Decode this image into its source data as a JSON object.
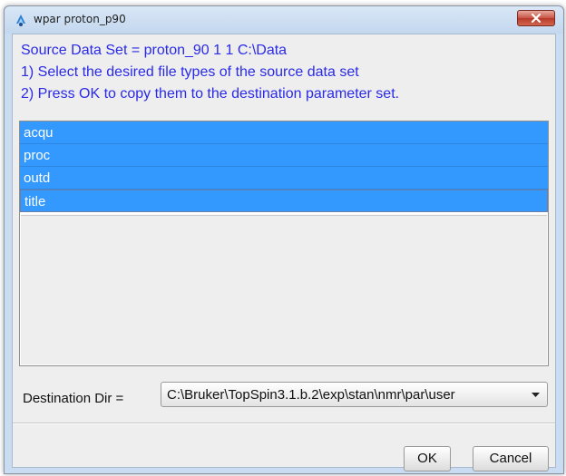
{
  "window": {
    "title": "wpar proton_p90"
  },
  "info": {
    "line1": "Source Data Set = proton_90  1  1  C:\\Data",
    "line2": "1) Select the desired file types of the source data set",
    "line3": "2) Press OK to copy them to the destination parameter set."
  },
  "file_types": [
    {
      "label": "acqu",
      "selected": true
    },
    {
      "label": "proc",
      "selected": true
    },
    {
      "label": "outd",
      "selected": true
    },
    {
      "label": "title",
      "selected": true
    }
  ],
  "destination": {
    "label": "Destination Dir =",
    "value": "C:\\Bruker\\TopSpin3.1.b.2\\exp\\stan\\nmr\\par\\user"
  },
  "buttons": {
    "ok": "OK",
    "cancel": "Cancel"
  },
  "colors": {
    "selection": "#3399ff",
    "info_text": "#2a2ae8",
    "close_button": "#c75547"
  },
  "icons": {
    "app": "topspin-app-icon",
    "close": "close-icon",
    "dropdown": "chevron-down-icon"
  }
}
